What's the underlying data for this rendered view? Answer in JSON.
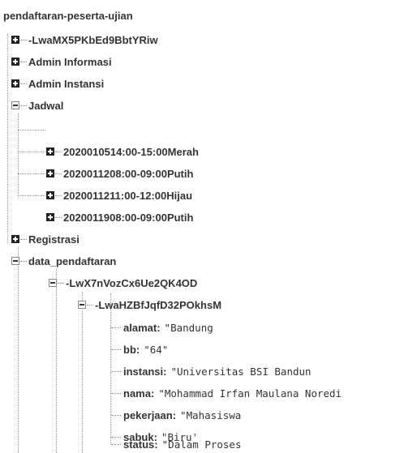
{
  "tree": {
    "root": "pendaftaran-peserta-ujian",
    "items": [
      {
        "label": "-LwaMX5PKbEd9BbtYRiw",
        "state": "collapsed"
      },
      {
        "label": "Admin Informasi",
        "state": "collapsed"
      },
      {
        "label": "Admin Instansi",
        "state": "collapsed"
      },
      {
        "label": "Jadwal",
        "state": "expanded"
      },
      {
        "label": "2020010514:00-15:00Merah",
        "state": "collapsed"
      },
      {
        "label": "2020011208:00-09:00Putih",
        "state": "collapsed"
      },
      {
        "label": "2020011211:00-12:00Hijau",
        "state": "collapsed"
      },
      {
        "label": "2020011908:00-09:00Putih",
        "state": "collapsed"
      },
      {
        "label": "Registrasi",
        "state": "collapsed"
      },
      {
        "label": "data_pendaftaran",
        "state": "expanded"
      },
      {
        "label": "-LwX7nVozCx6Ue2QK4OD",
        "state": "expanded"
      },
      {
        "label": "-LwaHZBfJqfD32POkhsM",
        "state": "expanded"
      }
    ],
    "fields": [
      {
        "key": "alamat",
        "value": "\"Bandung"
      },
      {
        "key": "bb",
        "value": "\"64\""
      },
      {
        "key": "instansi",
        "value": "\"Universitas BSI Bandun"
      },
      {
        "key": "nama",
        "value": "\"Mohammad Irfan Maulana Noredi"
      },
      {
        "key": "pekerjaan",
        "value": "\"Mahasiswa"
      },
      {
        "key": "sabuk",
        "value": "\"Biru'"
      },
      {
        "key": "status",
        "value": "\"Dalam Proses"
      }
    ]
  }
}
